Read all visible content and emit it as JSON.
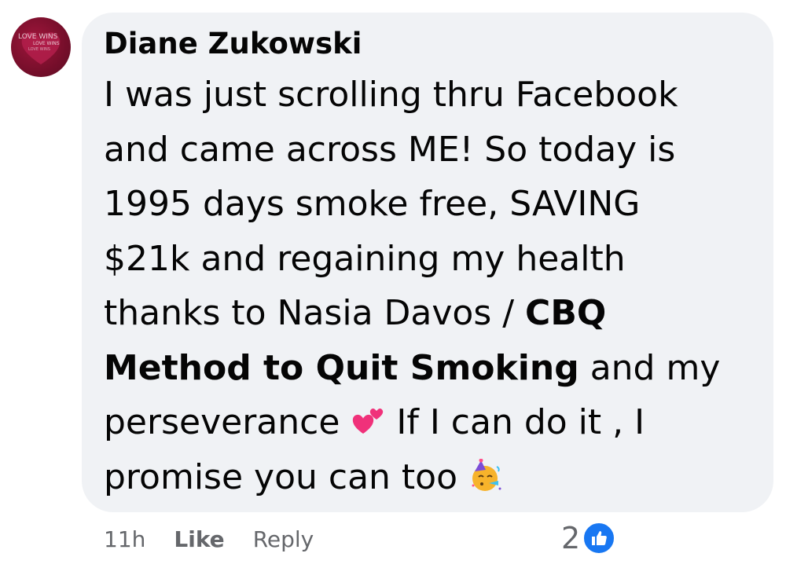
{
  "comment": {
    "author": "Diane Zukowski",
    "lines": [
      "I was just scrolling thru Facebook",
      "and came across ME! So today is",
      "1995 days smoke free, SAVING",
      "$21k and regaining my health",
      "thanks to Nasia Davos / ",
      "CBQ",
      "Method to Quit Smoking",
      " and my",
      "perseverance ",
      "  If I can do it , I",
      "promise you can too "
    ],
    "emojis": [
      "two-hearts-icon",
      "partying-face-icon"
    ]
  },
  "avatar": {
    "text_line1": "LOVE WINS",
    "text_line2": "LOVE WINS",
    "text_line3": "LOVE WINS",
    "color": "#8b1234"
  },
  "actions": {
    "time": "11h",
    "like_label": "Like",
    "reply_label": "Reply"
  },
  "reactions": {
    "count": "2",
    "type": "like-icon",
    "color": "#1877f2"
  },
  "colors": {
    "bubble": "#f0f2f5",
    "text": "#050505",
    "secondary_text": "#65676b"
  }
}
